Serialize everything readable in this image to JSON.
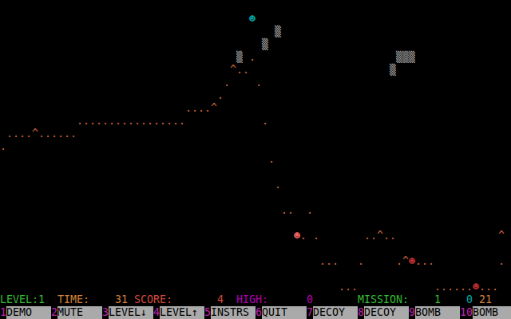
{
  "playfield": {
    "items": [
      {
        "text": "☻",
        "row": 1,
        "col": 39,
        "kind": "player",
        "color": "#00aaaa"
      },
      {
        "text": "▒",
        "row": 2,
        "col": 43,
        "kind": "cloud",
        "color": "#aaaaaa"
      },
      {
        "text": "▒",
        "row": 3,
        "col": 41,
        "kind": "cloud",
        "color": "#aaaaaa"
      },
      {
        "text": "▒",
        "row": 4,
        "col": 37,
        "kind": "cloud",
        "color": "#aaaaaa"
      },
      {
        "text": ".",
        "row": 4,
        "col": 39,
        "kind": "terrain",
        "color": "#d0643c"
      },
      {
        "text": "▒▒▒",
        "row": 4,
        "col": 62,
        "kind": "cloud",
        "color": "#aaaaaa"
      },
      {
        "text": "^..",
        "row": 5,
        "col": 36,
        "kind": "terrain",
        "color": "#d0643c"
      },
      {
        "text": "▒",
        "row": 5,
        "col": 61,
        "kind": "cloud",
        "color": "#aaaaaa"
      },
      {
        "text": ".",
        "row": 6,
        "col": 35,
        "kind": "terrain",
        "color": "#d0643c"
      },
      {
        "text": ".",
        "row": 6,
        "col": 40,
        "kind": "terrain",
        "color": "#d0643c"
      },
      {
        "text": ".",
        "row": 7,
        "col": 34,
        "kind": "terrain",
        "color": "#d0643c"
      },
      {
        "text": "....^",
        "row": 8,
        "col": 29,
        "kind": "terrain",
        "color": "#d0643c"
      },
      {
        "text": ".................",
        "row": 9,
        "col": 12,
        "kind": "terrain",
        "color": "#d0643c"
      },
      {
        "text": ".",
        "row": 9,
        "col": 41,
        "kind": "terrain",
        "color": "#d0643c"
      },
      {
        "text": "....^......",
        "row": 10,
        "col": 1,
        "kind": "terrain",
        "color": "#d0643c"
      },
      {
        "text": ".",
        "row": 11,
        "col": 0,
        "kind": "terrain",
        "color": "#d0643c"
      },
      {
        "text": ".",
        "row": 12,
        "col": 42,
        "kind": "terrain",
        "color": "#d0643c"
      },
      {
        "text": ".",
        "row": 14,
        "col": 43,
        "kind": "terrain",
        "color": "#d0643c"
      },
      {
        "text": "..",
        "row": 16,
        "col": 44,
        "kind": "terrain",
        "color": "#d0643c"
      },
      {
        "text": ".",
        "row": 16,
        "col": 48,
        "kind": "terrain",
        "color": "#d0643c"
      },
      {
        "text": "☻",
        "row": 18,
        "col": 46,
        "kind": "enemy",
        "color": "#ff6a6a"
      },
      {
        "text": ".",
        "row": 18,
        "col": 47,
        "kind": "terrain",
        "color": "#d0643c"
      },
      {
        "text": ".",
        "row": 18,
        "col": 49,
        "kind": "terrain",
        "color": "#d0643c"
      },
      {
        "text": "..^..",
        "row": 18,
        "col": 57,
        "kind": "terrain",
        "color": "#d0643c"
      },
      {
        "text": "^",
        "row": 18,
        "col": 78,
        "kind": "terrain",
        "color": "#d0643c"
      },
      {
        "text": "...",
        "row": 20,
        "col": 50,
        "kind": "terrain",
        "color": "#d0643c"
      },
      {
        "text": ".",
        "row": 20,
        "col": 56,
        "kind": "terrain",
        "color": "#d0643c"
      },
      {
        "text": ".^",
        "row": 20,
        "col": 62,
        "kind": "terrain",
        "color": "#d0643c"
      },
      {
        "text": "☻",
        "row": 20,
        "col": 64,
        "kind": "enemy",
        "color": "#c83030"
      },
      {
        "text": "...",
        "row": 20,
        "col": 65,
        "kind": "terrain",
        "color": "#d0643c"
      },
      {
        "text": ".",
        "row": 20,
        "col": 78,
        "kind": "terrain",
        "color": "#d0643c"
      },
      {
        "text": "...",
        "row": 22,
        "col": 53,
        "kind": "terrain",
        "color": "#d0643c"
      },
      {
        "text": "......",
        "row": 22,
        "col": 68,
        "kind": "terrain",
        "color": "#d0643c"
      },
      {
        "text": "☻",
        "row": 22,
        "col": 74,
        "kind": "enemy",
        "color": "#c83030"
      },
      {
        "text": "...",
        "row": 22,
        "col": 75,
        "kind": "terrain",
        "color": "#d0643c"
      }
    ]
  },
  "status": {
    "fields": [
      {
        "label": "LEVEL:",
        "value": "1",
        "color": "#33bb33"
      },
      {
        "label": "TIME:",
        "value": "31",
        "color": "#d0803a"
      },
      {
        "label": "SCORE:",
        "value": "4",
        "color": "#d04a3a"
      },
      {
        "label": "HIGH:",
        "value": "0",
        "color": "#b000b0"
      },
      {
        "label": "MISSION:",
        "value": "1",
        "color": "#33bb33"
      }
    ],
    "counters": [
      {
        "value": "0",
        "color": "#00aaaa"
      },
      {
        "value": "21",
        "color": "#d0803a"
      }
    ]
  },
  "function_keys": [
    {
      "number": "1",
      "label": "DEMO"
    },
    {
      "number": "2",
      "label": "MUTE"
    },
    {
      "number": "3",
      "label": "LEVEL↓"
    },
    {
      "number": "4",
      "label": "LEVEL↑"
    },
    {
      "number": "5",
      "label": "INSTRS"
    },
    {
      "number": "6",
      "label": "QUIT"
    },
    {
      "number": "7",
      "label": "DECOY"
    },
    {
      "number": "8",
      "label": "DECOY"
    },
    {
      "number": "9",
      "label": "BOMB"
    },
    {
      "number": "10",
      "label": "BOMB"
    }
  ]
}
